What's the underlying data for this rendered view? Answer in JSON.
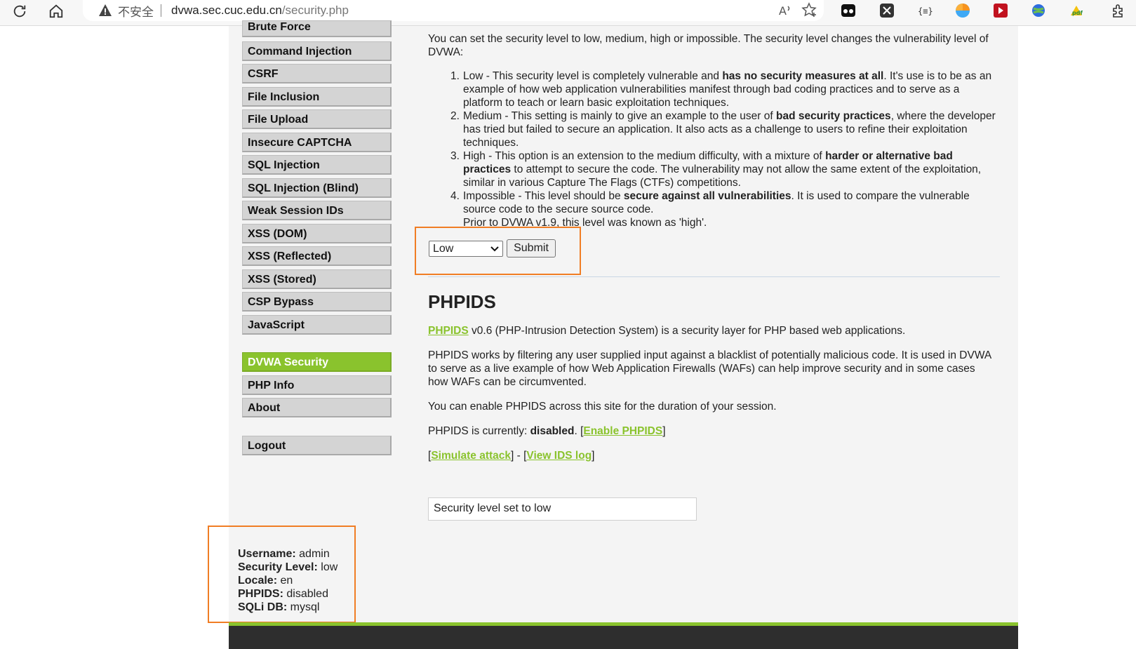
{
  "browser": {
    "insecure_label": "不安全",
    "url_host": "dvwa.sec.cuc.edu.cn",
    "url_path": "/security.php"
  },
  "menu": {
    "items": [
      {
        "label": "Brute Force"
      },
      {
        "label": "Command Injection"
      },
      {
        "label": "CSRF"
      },
      {
        "label": "File Inclusion"
      },
      {
        "label": "File Upload"
      },
      {
        "label": "Insecure CAPTCHA"
      },
      {
        "label": "SQL Injection"
      },
      {
        "label": "SQL Injection (Blind)"
      },
      {
        "label": "Weak Session IDs"
      },
      {
        "label": "XSS (DOM)"
      },
      {
        "label": "XSS (Reflected)"
      },
      {
        "label": "XSS (Stored)"
      },
      {
        "label": "CSP Bypass"
      },
      {
        "label": "JavaScript"
      }
    ],
    "security": "DVWA Security",
    "phpinfo": "PHP Info",
    "about": "About",
    "logout": "Logout"
  },
  "content": {
    "intro": "You can set the security level to low, medium, high or impossible. The security level changes the vulnerability level of DVWA:",
    "levels": [
      {
        "n": "1.",
        "pre": "Low - This security level is completely vulnerable and ",
        "bold": "has no security measures at all",
        "post": ". It's use is to be as an example of how web application vulnerabilities manifest through bad coding practices and to serve as a platform to teach or learn basic exploitation techniques."
      },
      {
        "n": "2.",
        "pre": "Medium - This setting is mainly to give an example to the user of ",
        "bold": "bad security practices",
        "post": ", where the developer has tried but failed to secure an application. It also acts as a challenge to users to refine their exploitation techniques."
      },
      {
        "n": "3.",
        "pre": "High - This option is an extension to the medium difficulty, with a mixture of ",
        "bold": "harder or alternative bad practices",
        "post": " to attempt to secure the code. The vulnerability may not allow the same extent of the exploitation, similar in various Capture The Flags (CTFs) competitions."
      },
      {
        "n": "4.",
        "pre": "Impossible - This level should be ",
        "bold": "secure against all vulnerabilities",
        "post": ". It is used to compare the vulnerable source code to the secure source code."
      }
    ],
    "level4_note": "Prior to DVWA v1.9, this level was known as 'high'.",
    "select_value": "Low",
    "submit_label": "Submit",
    "phpids_heading": "PHPIDS",
    "phpids_link": "PHPIDS",
    "phpids_desc": " v0.6 (PHP-Intrusion Detection System) is a security layer for PHP based web applications.",
    "phpids_works": "PHPIDS works by filtering any user supplied input against a blacklist of potentially malicious code. It is used in DVWA to serve as a live example of how Web Application Firewalls (WAFs) can help improve security and in some cases how WAFs can be circumvented.",
    "phpids_enable_text": "You can enable PHPIDS across this site for the duration of your session.",
    "phpids_status_prefix": "PHPIDS is currently: ",
    "phpids_status": "disabled",
    "phpids_status_mid": ". [",
    "enable_link": "Enable PHPIDS",
    "bracket_close": "]",
    "simulate_link": "Simulate attack",
    "view_log_link": "View IDS log",
    "bracket_open": "[",
    "link_sep": "] - [",
    "status_message": "Security level set to low"
  },
  "user_info": {
    "username_label": "Username:",
    "username": "admin",
    "security_label": "Security Level:",
    "security": "low",
    "locale_label": "Locale:",
    "locale": "en",
    "phpids_label": "PHPIDS:",
    "phpids": "disabled",
    "sqli_label": "SQLi DB:",
    "sqli": "mysql"
  },
  "colors": {
    "accent": "#8ac32d",
    "highlight_box": "#f07d24"
  }
}
